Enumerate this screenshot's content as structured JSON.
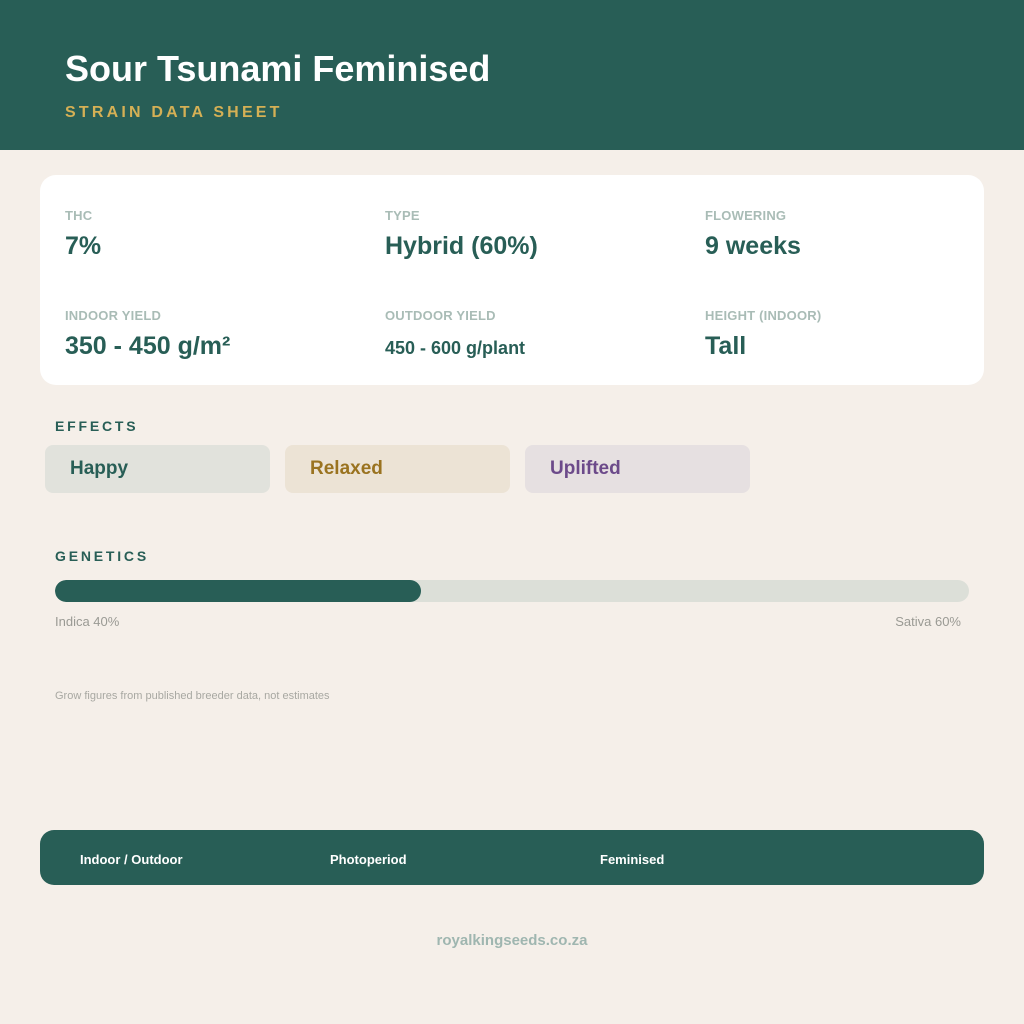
{
  "header": {
    "title": "Sour Tsunami Feminised",
    "subtitle": "STRAIN DATA SHEET"
  },
  "stats": [
    {
      "label": "THC",
      "value": "7%"
    },
    {
      "label": "TYPE",
      "value": "Hybrid (60%)"
    },
    {
      "label": "FLOWERING",
      "value": "9 weeks"
    },
    {
      "label": "INDOOR YIELD",
      "value": "350 - 450 g/m²"
    },
    {
      "label": "OUTDOOR YIELD",
      "value": "450 - 600 g/plant"
    },
    {
      "label": "HEIGHT (INDOOR)",
      "value": "Tall"
    }
  ],
  "effects": {
    "heading": "EFFECTS",
    "items": [
      {
        "label": "Happy",
        "bg": "#e1e2dc",
        "color": "#285e56"
      },
      {
        "label": "Relaxed",
        "bg": "#ece3d5",
        "color": "#9a7320"
      },
      {
        "label": "Uplifted",
        "bg": "#e6e0e1",
        "color": "#6c4a8a"
      }
    ]
  },
  "genetics": {
    "heading": "GENETICS",
    "indica_percent": 40,
    "sativa_percent": 60,
    "indica_label": "Indica 40%",
    "sativa_label": "Sativa 60%"
  },
  "note": "Grow figures from published breeder data, not estimates",
  "footer": {
    "items": [
      "Indoor / Outdoor",
      "Photoperiod",
      "Feminised"
    ]
  },
  "website": "royalkingseeds.co.za",
  "colors": {
    "primary": "#285e56",
    "accent": "#d5b055",
    "background": "#f5efe9"
  }
}
